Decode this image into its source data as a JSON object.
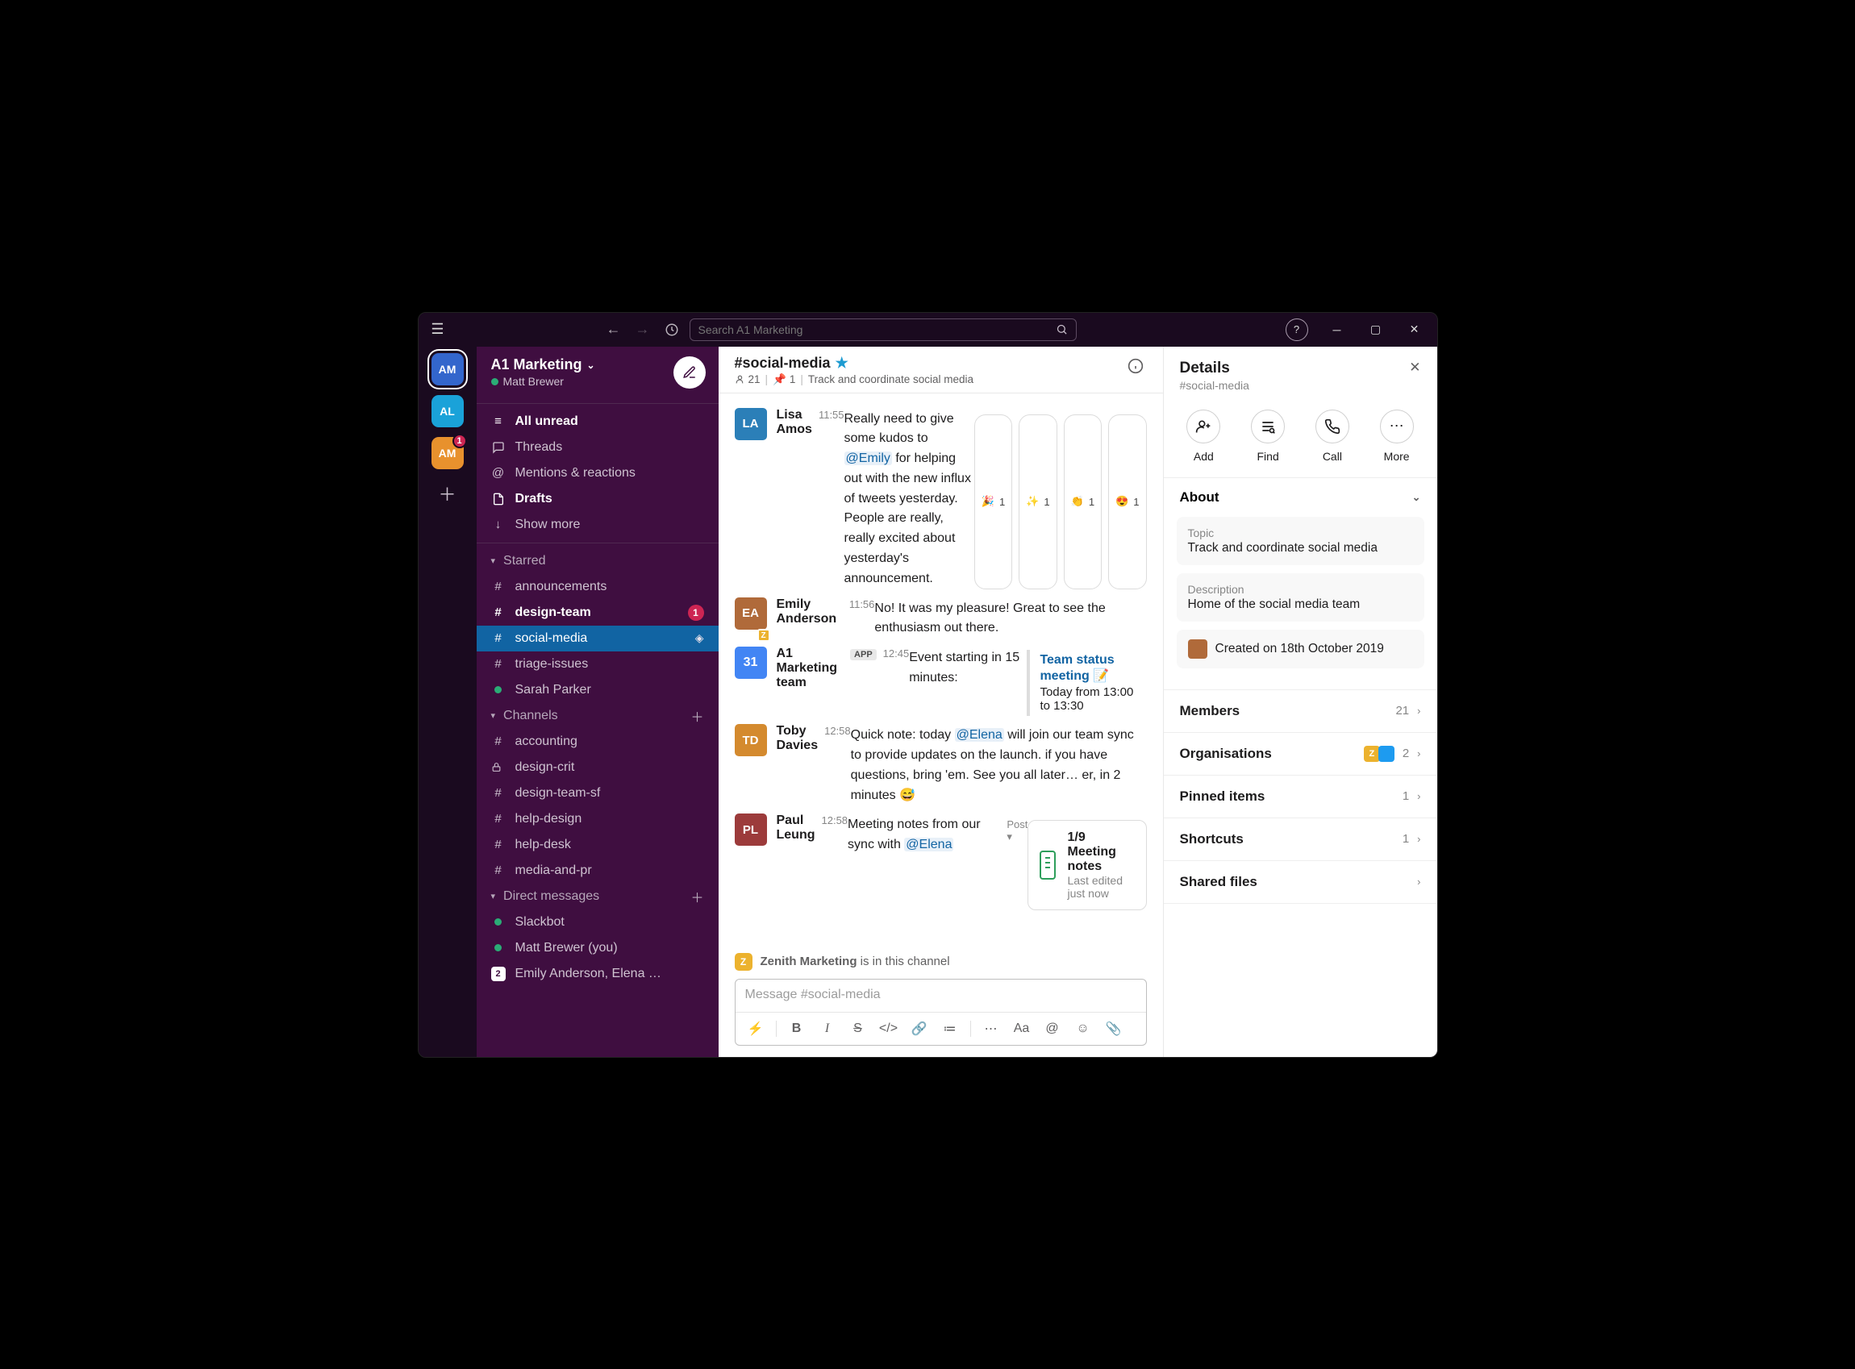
{
  "search_placeholder": "Search A1 Marketing",
  "workspaces": [
    {
      "id": "am",
      "initials": "AM",
      "color": "#3366cc",
      "active": true
    },
    {
      "id": "al",
      "initials": "AL",
      "color": "#1aa2d9"
    },
    {
      "id": "am2",
      "initials": "AM",
      "color": "#e8912d",
      "badge": "1"
    }
  ],
  "workspace": {
    "name": "A1 Marketing",
    "user_name": "Matt Brewer"
  },
  "nav": {
    "all_unread": "All unread",
    "threads": "Threads",
    "mentions": "Mentions & reactions",
    "drafts": "Drafts",
    "show_more": "Show more"
  },
  "sections": {
    "starred": "Starred",
    "channels": "Channels",
    "dms": "Direct messages"
  },
  "starred": [
    {
      "name": "announcements",
      "prefix": "#"
    },
    {
      "name": "design-team",
      "prefix": "#",
      "bold": true,
      "badge": "1"
    },
    {
      "name": "social-media",
      "prefix": "#",
      "active": true
    },
    {
      "name": "triage-issues",
      "prefix": "#"
    },
    {
      "name": "Sarah Parker",
      "prefix": "●",
      "presence": true
    }
  ],
  "channels": [
    {
      "name": "accounting",
      "prefix": "#"
    },
    {
      "name": "design-crit",
      "prefix": "lock"
    },
    {
      "name": "design-team-sf",
      "prefix": "#"
    },
    {
      "name": "help-design",
      "prefix": "#"
    },
    {
      "name": "help-desk",
      "prefix": "#"
    },
    {
      "name": "media-and-pr",
      "prefix": "#"
    }
  ],
  "dms": [
    {
      "name": "Slackbot",
      "presence": true
    },
    {
      "name": "Matt Brewer (you)",
      "presence": true
    },
    {
      "name": "Emily Anderson, Elena …",
      "count": "2"
    }
  ],
  "channel_header": {
    "name": "#social-media",
    "members": "21",
    "pins": "1",
    "topic": "Track and coordinate social media"
  },
  "messages": [
    {
      "author": "Lisa Amos",
      "ts": "11:55",
      "avatar_color": "#2b7fb8",
      "avatar_text": "LA",
      "text_pre": "Really need to give some kudos to ",
      "mention": "@Emily",
      "text_post": " for helping out with the new influx of tweets yesterday. People are really, really excited about yesterday's announcement.",
      "reactions": [
        {
          "e": "🎉",
          "n": "1"
        },
        {
          "e": "✨",
          "n": "1"
        },
        {
          "e": "👏",
          "n": "1"
        },
        {
          "e": "😍",
          "n": "1"
        }
      ]
    },
    {
      "author": "Emily Anderson",
      "ts": "11:56",
      "avatar_color": "#b06a3a",
      "avatar_text": "EA",
      "z": true,
      "text": "No! It was my pleasure! Great to see the enthusiasm out there."
    },
    {
      "author": "A1 Marketing team",
      "ts": "12:45",
      "app": true,
      "avatar_color": "#4285f4",
      "avatar_text": "31",
      "intro": "Event starting in 15 minutes:",
      "event_title": "Team status meeting 📝",
      "event_sub": "Today from 13:00 to 13:30"
    },
    {
      "author": "Toby Davies",
      "ts": "12:58",
      "avatar_color": "#d48a2e",
      "avatar_text": "TD",
      "text_pre": "Quick note: today ",
      "mention": "@Elena",
      "text_post": " will join our team sync to provide updates on the launch. if you have questions, bring 'em. See you all later… er, in 2 minutes 😅"
    },
    {
      "author": "Paul Leung",
      "ts": "12:58",
      "avatar_color": "#9c3b3b",
      "avatar_text": "PL",
      "text_pre": "Meeting notes from our sync with ",
      "mention": "@Elena",
      "text_post": "",
      "post_label": "Post ▾",
      "doc_title": "1/9 Meeting notes",
      "doc_sub": "Last edited just now"
    }
  ],
  "org_notice": {
    "org": "Zenith Marketing",
    "suffix": " is in this channel"
  },
  "composer": {
    "placeholder": "Message #social-media",
    "app_label": "APP"
  },
  "details": {
    "title": "Details",
    "sub": "#social-media",
    "actions": {
      "add": "Add",
      "find": "Find",
      "call": "Call",
      "more": "More"
    },
    "about_title": "About",
    "topic_label": "Topic",
    "topic_value": "Track and coordinate social media",
    "desc_label": "Description",
    "desc_value": "Home of the social media team",
    "created": "Created on 18th October 2019",
    "rows": {
      "members": {
        "label": "Members",
        "count": "21"
      },
      "orgs": {
        "label": "Organisations",
        "count": "2"
      },
      "pinned": {
        "label": "Pinned items",
        "count": "1"
      },
      "shortcuts": {
        "label": "Shortcuts",
        "count": "1"
      },
      "files": {
        "label": "Shared files"
      }
    }
  }
}
